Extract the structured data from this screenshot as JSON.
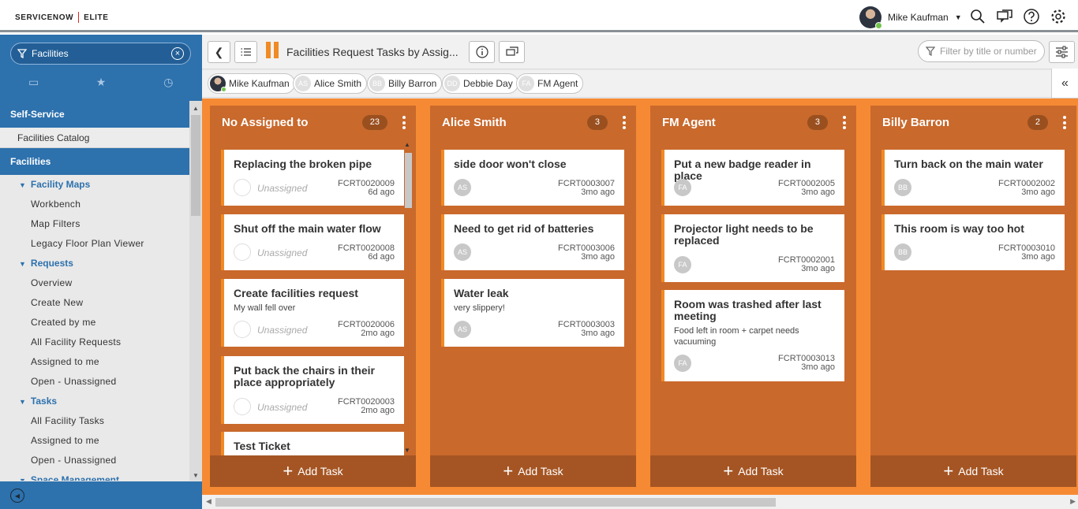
{
  "header": {
    "logo_left": "SERVICENOW",
    "logo_right": "ELITE",
    "user_name": "Mike Kaufman",
    "icons": [
      "search-icon",
      "chat-icon",
      "help-icon",
      "gear-icon"
    ]
  },
  "sidebar": {
    "filter_value": "Facilities",
    "tabs": [
      "archive-icon",
      "star-icon",
      "history-icon"
    ],
    "sections": {
      "self_service": "Self-Service",
      "facilities_catalog": "Facilities Catalog",
      "facilities": "Facilities"
    },
    "groups": {
      "facility_maps": "Facility Maps",
      "requests": "Requests",
      "tasks": "Tasks",
      "space_management": "Space Management"
    },
    "items": {
      "workbench": "Workbench",
      "map_filters": "Map Filters",
      "legacy_floor": "Legacy Floor Plan Viewer",
      "overview": "Overview",
      "create_new": "Create New",
      "created_by_me": "Created by me",
      "all_facility_requests": "All Facility Requests",
      "req_assigned_to_me": "Assigned to me",
      "req_open_unassigned": "Open - Unassigned",
      "all_facility_tasks": "All Facility Tasks",
      "task_assigned_to_me": "Assigned to me",
      "task_open_unassigned": "Open - Unassigned"
    }
  },
  "toolbar": {
    "title": "Facilities Request Tasks by Assig...",
    "filter_placeholder": "Filter by title or number",
    "accent": "#f08a24"
  },
  "members": [
    {
      "name": "Mike Kaufman",
      "initials": ""
    },
    {
      "name": "Alice Smith",
      "initials": "AS"
    },
    {
      "name": "Billy Barron",
      "initials": "BB"
    },
    {
      "name": "Debbie Day",
      "initials": "DD"
    },
    {
      "name": "FM Agent",
      "initials": "FA"
    }
  ],
  "lanes": [
    {
      "name": "No Assigned to",
      "count": "23",
      "add_label": "Add Task",
      "cards": [
        {
          "title": "Replacing the broken pipe",
          "desc": "",
          "assignee": "Unassigned",
          "initials": "",
          "number": "FCRT0020009",
          "age": "6d ago"
        },
        {
          "title": "Shut off the main water flow",
          "desc": "",
          "assignee": "Unassigned",
          "initials": "",
          "number": "FCRT0020008",
          "age": "6d ago"
        },
        {
          "title": "Create facilities request",
          "desc": "My wall fell over",
          "assignee": "Unassigned",
          "initials": "",
          "number": "FCRT0020006",
          "age": "2mo ago"
        },
        {
          "title": "Put back the chairs in their place appropriately",
          "desc": "",
          "assignee": "Unassigned",
          "initials": "",
          "number": "FCRT0020003",
          "age": "2mo ago"
        },
        {
          "title": "Test Ticket",
          "desc": "",
          "assignee": "",
          "initials": "",
          "number": "",
          "age": ""
        }
      ]
    },
    {
      "name": "Alice Smith",
      "count": "3",
      "add_label": "Add Task",
      "cards": [
        {
          "title": "side door won't close",
          "desc": "",
          "assignee": "",
          "initials": "AS",
          "number": "FCRT0003007",
          "age": "3mo ago"
        },
        {
          "title": "Need to get rid of batteries",
          "desc": "",
          "assignee": "",
          "initials": "AS",
          "number": "FCRT0003006",
          "age": "3mo ago"
        },
        {
          "title": "Water leak",
          "desc": "very slippery!",
          "assignee": "",
          "initials": "AS",
          "number": "FCRT0003003",
          "age": "3mo ago"
        }
      ]
    },
    {
      "name": "FM Agent",
      "count": "3",
      "add_label": "Add Task",
      "cards": [
        {
          "title": "Put a new badge reader in place",
          "desc": "",
          "assignee": "",
          "initials": "FA",
          "number": "FCRT0002005",
          "age": "3mo ago"
        },
        {
          "title": "Projector light needs to be replaced",
          "desc": "",
          "assignee": "",
          "initials": "FA",
          "number": "FCRT0002001",
          "age": "3mo ago"
        },
        {
          "title": "Room was trashed after last meeting",
          "desc": "Food left in room + carpet needs vacuuming",
          "assignee": "",
          "initials": "FA",
          "number": "FCRT0003013",
          "age": "3mo ago"
        }
      ]
    },
    {
      "name": "Billy Barron",
      "count": "2",
      "add_label": "Add Task",
      "cards": [
        {
          "title": "Turn back on the main water",
          "desc": "",
          "assignee": "",
          "initials": "BB",
          "number": "FCRT0002002",
          "age": "3mo ago"
        },
        {
          "title": "This room is way too hot",
          "desc": "",
          "assignee": "",
          "initials": "BB",
          "number": "FCRT0003010",
          "age": "3mo ago"
        }
      ]
    }
  ]
}
